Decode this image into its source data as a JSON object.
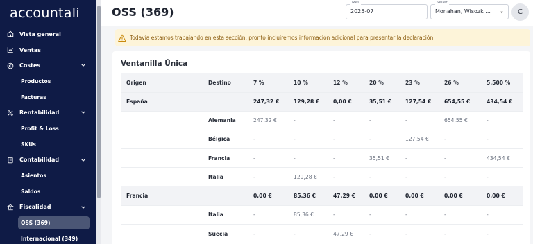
{
  "brand": "accountali",
  "nav": [
    {
      "label": "Vista general",
      "icon": "home-icon",
      "type": "top"
    },
    {
      "label": "Ventas",
      "icon": "chart-icon",
      "type": "top"
    },
    {
      "label": "Costes",
      "icon": "euro-icon",
      "type": "group",
      "expanded": true
    },
    {
      "label": "Productos",
      "type": "sub"
    },
    {
      "label": "Facturas",
      "type": "sub"
    },
    {
      "label": "Rentabilidad",
      "icon": "percent-icon",
      "type": "group",
      "expanded": true
    },
    {
      "label": "Profit & Loss",
      "type": "sub"
    },
    {
      "label": "SKUs",
      "type": "sub"
    },
    {
      "label": "Contabilidad",
      "icon": "book-icon",
      "type": "group",
      "expanded": true
    },
    {
      "label": "Asientos",
      "type": "sub"
    },
    {
      "label": "Saldos",
      "type": "sub"
    },
    {
      "label": "Fiscalidad",
      "icon": "bank-icon",
      "type": "group",
      "expanded": true
    },
    {
      "label": "OSS (369)",
      "type": "sub",
      "active": true
    },
    {
      "label": "Internacional (349)",
      "type": "sub"
    }
  ],
  "header": {
    "title": "OSS (369)",
    "month_label": "Mes",
    "month_value": "2025-07",
    "seller_label": "Seller",
    "seller_value": "Monahan, Wisozk ...",
    "avatar_initial": "C"
  },
  "alert": {
    "text": "Todavía estamos trabajando en esta sección, pronto incluiremos información adicional para presentar la declaración."
  },
  "card": {
    "title": "Ventanilla Única",
    "columns": [
      "Origen",
      "Destino",
      "7 %",
      "10 %",
      "12 %",
      "20 %",
      "23 %",
      "26 %",
      "5.500 %"
    ],
    "rows": [
      {
        "group": true,
        "cells": [
          "España",
          "",
          "247,32 €",
          "129,28 €",
          "0,00 €",
          "35,51 €",
          "127,54 €",
          "654,55 €",
          "434,54 €"
        ]
      },
      {
        "group": false,
        "cells": [
          "",
          "Alemania",
          "247,32 €",
          "-",
          "-",
          "-",
          "-",
          "654,55 €",
          "-"
        ]
      },
      {
        "group": false,
        "cells": [
          "",
          "Bélgica",
          "-",
          "-",
          "-",
          "-",
          "127,54 €",
          "-",
          "-"
        ]
      },
      {
        "group": false,
        "cells": [
          "",
          "Francia",
          "-",
          "-",
          "-",
          "35,51 €",
          "-",
          "-",
          "434,54 €"
        ]
      },
      {
        "group": false,
        "cells": [
          "",
          "Italia",
          "-",
          "129,28 €",
          "-",
          "-",
          "-",
          "-",
          "-"
        ]
      },
      {
        "group": true,
        "cells": [
          "Francia",
          "",
          "0,00 €",
          "85,36 €",
          "47,29 €",
          "0,00 €",
          "0,00 €",
          "0,00 €",
          "0,00 €"
        ]
      },
      {
        "group": false,
        "cells": [
          "",
          "Italia",
          "-",
          "85,36 €",
          "-",
          "-",
          "-",
          "-",
          "-"
        ]
      },
      {
        "group": false,
        "cells": [
          "",
          "Suecia",
          "-",
          "-",
          "47,29 €",
          "-",
          "-",
          "-",
          "-"
        ]
      }
    ]
  }
}
